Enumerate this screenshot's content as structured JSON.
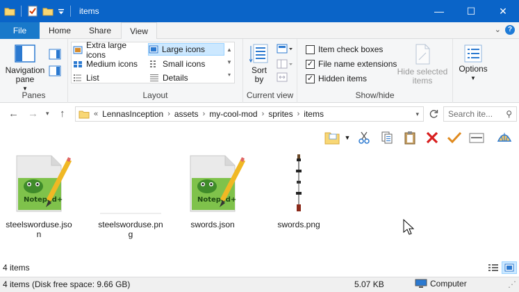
{
  "window": {
    "title": "items",
    "minimize_glyph": "—",
    "maximize_glyph": "☐",
    "close_glyph": "✕"
  },
  "tabs": [
    "File",
    "Home",
    "Share",
    "View"
  ],
  "ribbon": {
    "panes": {
      "navigation_pane": "Navigation\npane",
      "group_label": "Panes"
    },
    "layout": {
      "options": [
        "Extra large icons",
        "Large icons",
        "Medium icons",
        "Small icons",
        "List",
        "Details"
      ],
      "selected": "Large icons",
      "group_label": "Layout"
    },
    "current_view": {
      "sort_by": "Sort\nby",
      "group_label": "Current view"
    },
    "show_hide": {
      "item_check_boxes": {
        "label": "Item check boxes",
        "checked": false
      },
      "file_name_extensions": {
        "label": "File name extensions",
        "checked": true
      },
      "hidden_items": {
        "label": "Hidden items",
        "checked": true
      },
      "hide_selected_items": "Hide selected\nitems",
      "group_label": "Show/hide"
    },
    "options": {
      "label": "Options"
    }
  },
  "address": {
    "breadcrumbs": [
      "LennasInception",
      "assets",
      "my-cool-mod",
      "sprites",
      "items"
    ],
    "search_placeholder": "Search ite..."
  },
  "files": [
    {
      "name": "steelsworduse.json",
      "kind": "notepad"
    },
    {
      "name": "steelsworduse.png",
      "kind": "blank"
    },
    {
      "name": "swords.json",
      "kind": "notepad"
    },
    {
      "name": "swords.png",
      "kind": "sword"
    }
  ],
  "status": {
    "item_count": "4 items",
    "disk_info": "4 items (Disk free space: 9.66 GB)",
    "size": "5.07 KB",
    "location": "Computer"
  },
  "colors": {
    "title_bar": "#0a64c8",
    "file_tab": "#1979ca",
    "selection": "#cce8ff"
  }
}
